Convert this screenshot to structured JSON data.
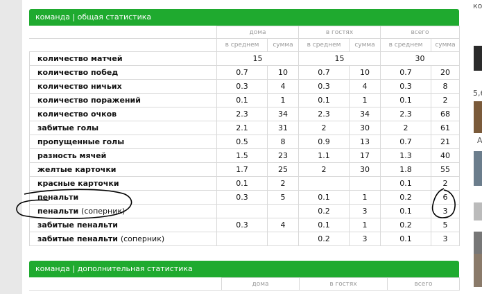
{
  "right_strip": {
    "top_text": "кон",
    "middle_text": "5,6",
    "side_text": "А"
  },
  "stats": {
    "title": "команда | общая статистика",
    "groups": [
      "дома",
      "в гостях",
      "всего"
    ],
    "sub": [
      "в среднем",
      "сумма",
      "в среднем",
      "сумма",
      "в среднем",
      "сумма"
    ],
    "matches": {
      "label": "количество матчей",
      "home": "15",
      "away": "15",
      "total": "30"
    },
    "rows": [
      {
        "label": "количество побед",
        "suffix": "",
        "v": [
          "0.7",
          "10",
          "0.7",
          "10",
          "0.7",
          "20"
        ]
      },
      {
        "label": "количество ничьих",
        "suffix": "",
        "v": [
          "0.3",
          "4",
          "0.3",
          "4",
          "0.3",
          "8"
        ]
      },
      {
        "label": "количество поражений",
        "suffix": "",
        "v": [
          "0.1",
          "1",
          "0.1",
          "1",
          "0.1",
          "2"
        ]
      },
      {
        "label": "количество очков",
        "suffix": "",
        "v": [
          "2.3",
          "34",
          "2.3",
          "34",
          "2.3",
          "68"
        ]
      },
      {
        "label": "забитые голы",
        "suffix": "",
        "v": [
          "2.1",
          "31",
          "2",
          "30",
          "2",
          "61"
        ]
      },
      {
        "label": "пропущенные голы",
        "suffix": "",
        "v": [
          "0.5",
          "8",
          "0.9",
          "13",
          "0.7",
          "21"
        ]
      },
      {
        "label": "разность мячей",
        "suffix": "",
        "v": [
          "1.5",
          "23",
          "1.1",
          "17",
          "1.3",
          "40"
        ]
      },
      {
        "label": "желтые карточки",
        "suffix": "",
        "v": [
          "1.7",
          "25",
          "2",
          "30",
          "1.8",
          "55"
        ]
      },
      {
        "label": "красные карточки",
        "suffix": "",
        "v": [
          "0.1",
          "2",
          "",
          "",
          "0.1",
          "2"
        ]
      },
      {
        "label": "пенальти",
        "suffix": "",
        "v": [
          "0.3",
          "5",
          "0.1",
          "1",
          "0.2",
          "6"
        ]
      },
      {
        "label": "пенальти",
        "suffix": "(соперник)",
        "v": [
          "",
          "",
          "0.2",
          "3",
          "0.1",
          "3"
        ]
      },
      {
        "label": "забитые пенальти",
        "suffix": "",
        "v": [
          "0.3",
          "4",
          "0.1",
          "1",
          "0.2",
          "5"
        ]
      },
      {
        "label": "забитые пенальти",
        "suffix": "(соперник)",
        "v": [
          "",
          "",
          "0.2",
          "3",
          "0.1",
          "3"
        ]
      }
    ]
  },
  "extra": {
    "title": "команда | дополнительная статистика",
    "groups": [
      "дома",
      "в гостях",
      "всего"
    ]
  }
}
